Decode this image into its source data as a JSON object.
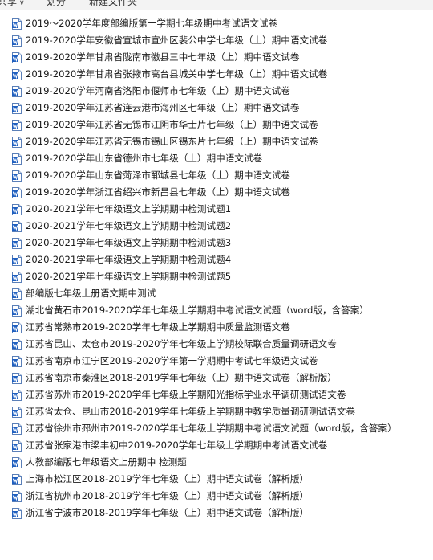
{
  "toolbar": {
    "items": [
      "共享",
      "划分",
      "新建文件夹"
    ]
  },
  "icons": {
    "file": "word-document-icon",
    "accent": "#1f5fbf"
  },
  "files": [
    "2019～2020学年度部编版第一学期七年级期中考试语文试卷",
    "2019-2020学年安徽省宣城市宣州区裴公中学七年级（上）期中语文试卷",
    "2019-2020学年甘肃省陇南市徽县三中七年级（上）期中语文试卷",
    "2019-2020学年甘肃省张掖市高台县城关中学七年级（上）期中语文试卷",
    "2019-2020学年河南省洛阳市偃师市七年级（上）期中语文试卷",
    "2019-2020学年江苏省连云港市海州区七年级（上）期中语文试卷",
    "2019-2020学年江苏省无锡市江阴市华士片七年级（上）期中语文试卷",
    "2019-2020学年江苏省无锡市锡山区锡东片七年级（上）期中语文试卷",
    "2019-2020学年山东省德州市七年级（上）期中语文试卷",
    "2019-2020学年山东省菏泽市郓城县七年级（上）期中语文试卷",
    "2019-2020学年浙江省绍兴市新昌县七年级（上）期中语文试卷",
    "2020-2021学年七年级语文上学期期中检测试题1",
    "2020-2021学年七年级语文上学期期中检测试题2",
    "2020-2021学年七年级语文上学期期中检测试题3",
    "2020-2021学年七年级语文上学期期中检测试题4",
    "2020-2021学年七年级语文上学期期中检测试题5",
    "部编版七年级上册语文期中测试",
    "湖北省黄石市2019-2020学年七年级上学期期中考试语文试题（word版，含答案）",
    "江苏省常熟市2019-2020学年七年级上学期期中质量监测语文卷",
    "江苏省昆山、太仓市2019-2020学年七年级上学期校际联合质量调研语文卷",
    "江苏省南京市江宁区2019-2020学年第一学期期中考试七年级语文试卷",
    "江苏省南京市秦淮区2018-2019学年七年级（上）期中语文试卷（解析版）",
    "江苏省苏州市2019-2020学年七年级上学期阳光指标学业水平调研测试语文卷",
    "江苏省太仓、昆山市2018-2019学年七年级上学期期中教学质量调研测试语文卷",
    "江苏省徐州市邳州市2019-2020学年七年级上学期期中考试语文试题（word版，含答案）",
    "江苏省张家港市梁丰初中2019-2020学年七年级上学期期中考试语文试卷",
    "人教部编版七年级语文上册期中 检测题",
    "上海市松江区2018-2019学年七年级（上）期中语文试卷（解析版）",
    "浙江省杭州市2018-2019学年七年级（上）期中语文试卷（解析版）",
    "浙江省宁波市2018-2019学年七年级（上）期中语文试卷（解析版）"
  ]
}
